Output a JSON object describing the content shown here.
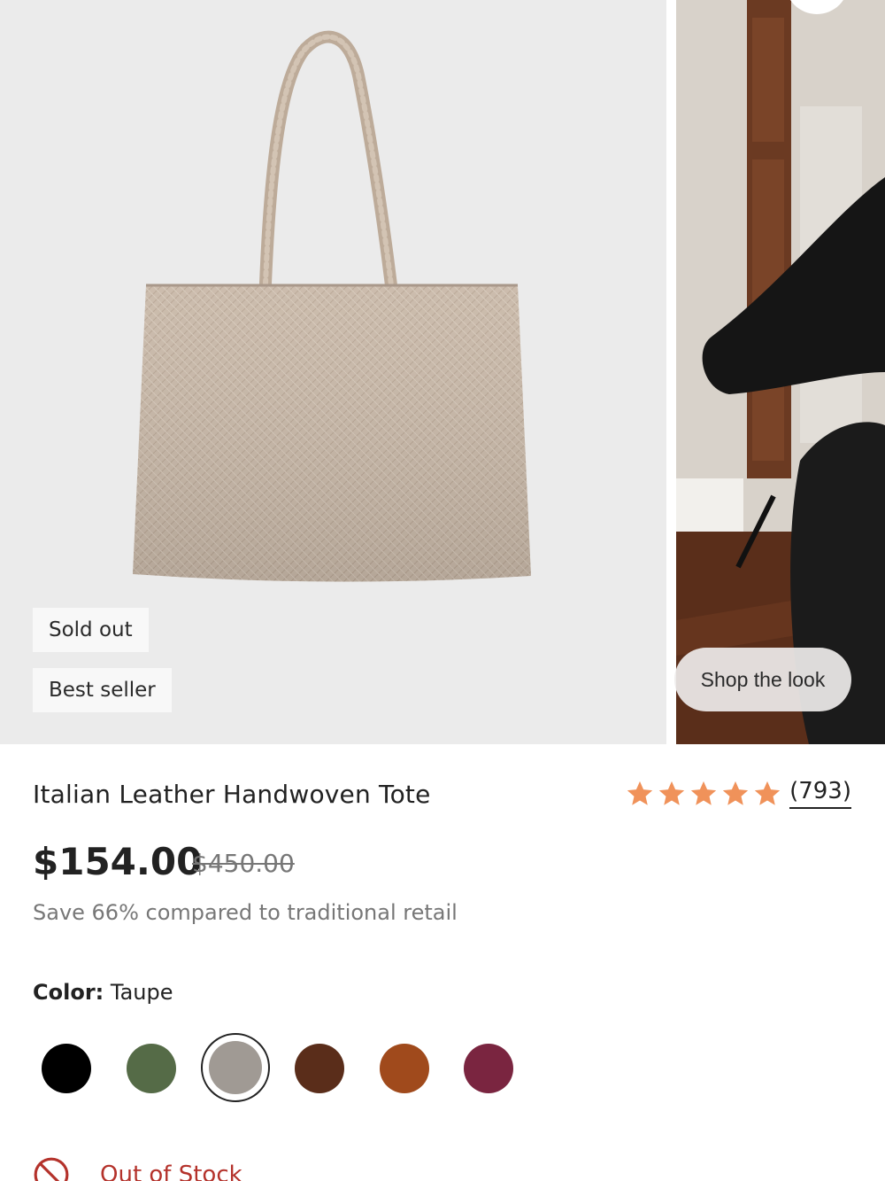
{
  "badges": {
    "sold_out": "Sold out",
    "best_seller": "Best seller"
  },
  "gallery": {
    "shop_the_look": "Shop the look"
  },
  "product": {
    "title": "Italian Leather Handwoven Tote",
    "rating": 5,
    "review_count": "(793)",
    "price": "$154.00",
    "compare_price": "$450.00",
    "savings": "Save 66% compared to traditional retail"
  },
  "color": {
    "label": "Color:",
    "selected": "Taupe",
    "swatches": [
      {
        "hex": "#000000"
      },
      {
        "hex": "#556b47"
      },
      {
        "hex": "#a09a94",
        "selected": true
      },
      {
        "hex": "#5a2d1a"
      },
      {
        "hex": "#a04a1c"
      },
      {
        "hex": "#7a2540"
      }
    ]
  },
  "stock": {
    "status": "Out of Stock"
  },
  "colors": {
    "star": "#f0925a",
    "out_of_stock": "#b4322b"
  }
}
